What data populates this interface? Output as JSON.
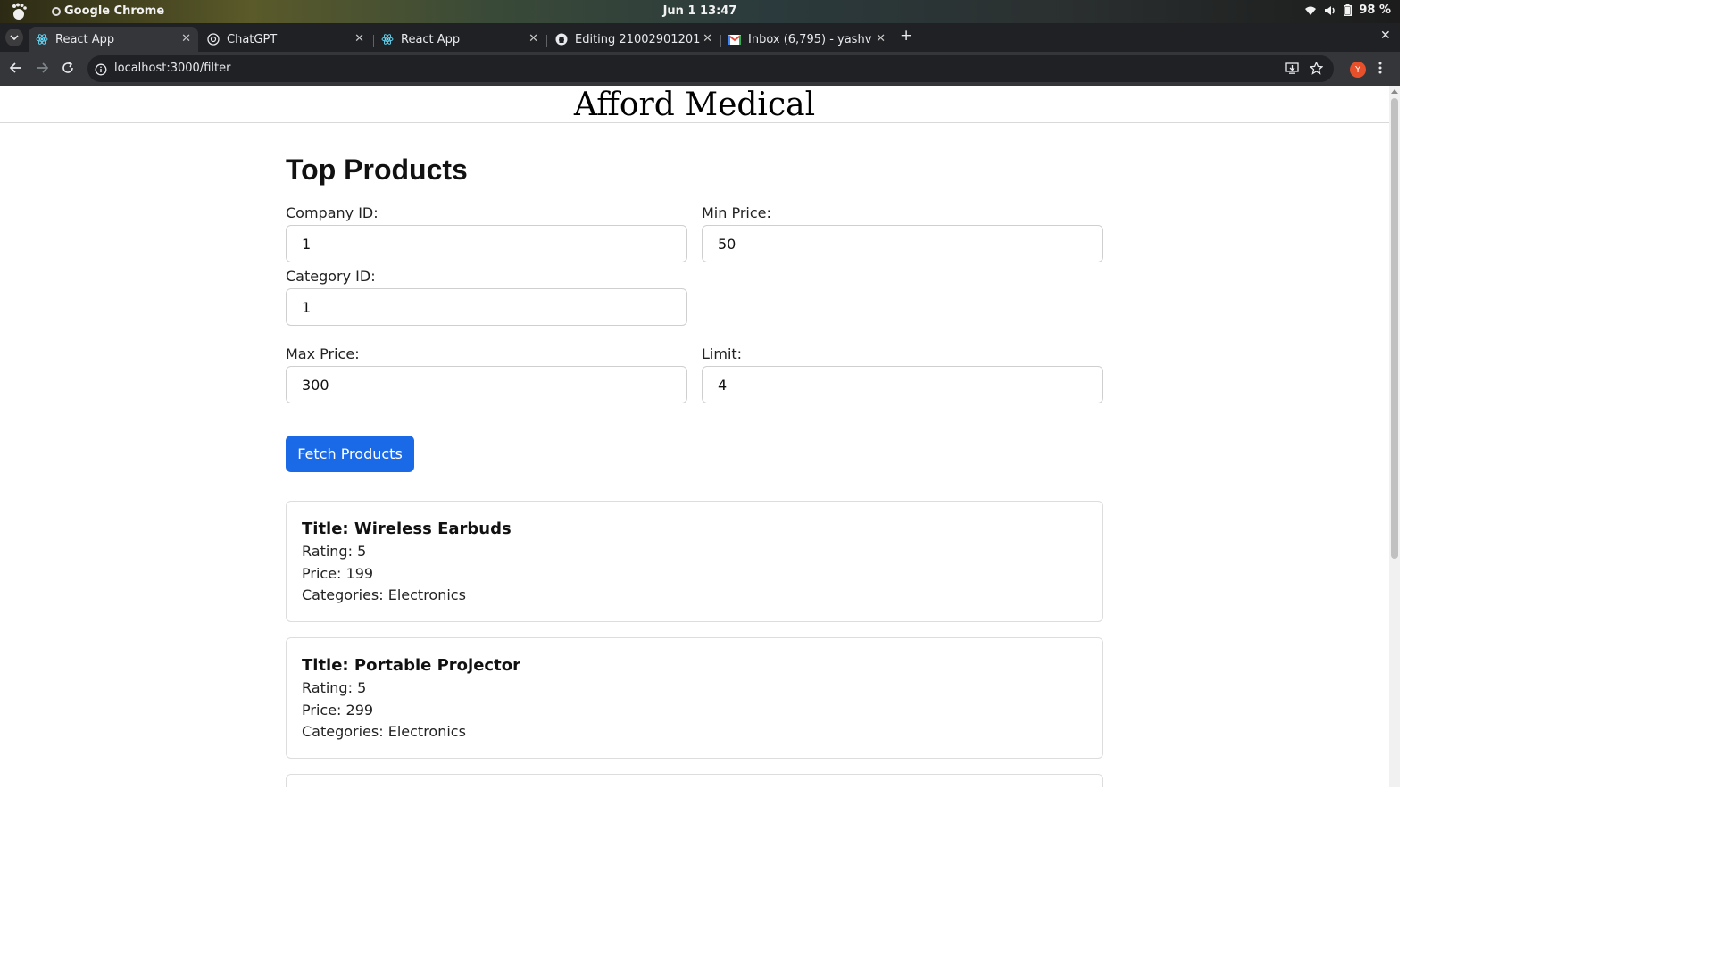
{
  "os_bar": {
    "app_name": "Google Chrome",
    "clock": "Jun 1  13:47",
    "battery": "98 %",
    "icons": [
      "gnome-foot-icon",
      "wifi-icon",
      "volume-icon",
      "battery-icon"
    ]
  },
  "browser": {
    "tabs": [
      {
        "label": "React App",
        "icon": "react-icon",
        "active": true
      },
      {
        "label": "ChatGPT",
        "icon": "chatgpt-icon",
        "active": false
      },
      {
        "label": "React App",
        "icon": "react-icon",
        "active": false
      },
      {
        "label": "Editing 21002901201",
        "icon": "github-icon",
        "active": false
      },
      {
        "label": "Inbox (6,795) - yashv",
        "icon": "gmail-icon",
        "active": false
      }
    ],
    "new_tab_symbol": "+",
    "close_symbol": "✕",
    "url": "localhost:3000/filter",
    "profile_initial": "Y"
  },
  "page": {
    "site_title": "Afford Medical",
    "heading": "Top Products",
    "fields": {
      "company_id": {
        "label": "Company ID:",
        "value": "1"
      },
      "min_price": {
        "label": "Min Price:",
        "value": "50"
      },
      "category_id": {
        "label": "Category ID:",
        "value": "1"
      },
      "max_price": {
        "label": "Max Price:",
        "value": "300"
      },
      "limit": {
        "label": "Limit:",
        "value": "4"
      }
    },
    "fetch_button": "Fetch Products",
    "products": [
      {
        "title": "Title: Wireless Earbuds",
        "rating": "Rating: 5",
        "price": "Price: 199",
        "categories": "Categories: Electronics"
      },
      {
        "title": "Title: Portable Projector",
        "rating": "Rating: 5",
        "price": "Price: 299",
        "categories": "Categories: Electronics"
      }
    ]
  },
  "colors": {
    "button_blue": "#1a6ae8",
    "tab_bar": "#202124",
    "toolbar": "#35363a"
  }
}
